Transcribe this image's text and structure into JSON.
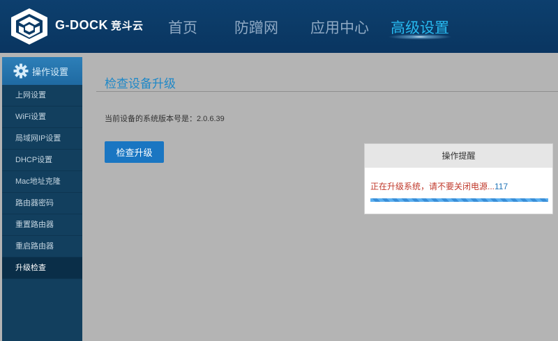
{
  "header": {
    "brand": "G-DOCK",
    "brand_cn": "竞斗云",
    "nav": [
      {
        "label": "首页"
      },
      {
        "label": "防蹭网"
      },
      {
        "label": "应用中心"
      },
      {
        "label": "高级设置"
      }
    ]
  },
  "sidebar": {
    "title": "操作设置",
    "items": [
      {
        "label": "上网设置"
      },
      {
        "label": "WiFi设置"
      },
      {
        "label": "局域网IP设置"
      },
      {
        "label": "DHCP设置"
      },
      {
        "label": "Mac地址克隆"
      },
      {
        "label": "路由器密码"
      },
      {
        "label": "重置路由器"
      },
      {
        "label": "重启路由器"
      },
      {
        "label": "升级检查"
      }
    ]
  },
  "main": {
    "title": "检查设备升级",
    "version_text": "当前设备的系统版本号是：2.0.6.39",
    "check_button": "检查升级"
  },
  "modal": {
    "title": "操作提醒",
    "message": "正在升级系统，请不要关闭电源...",
    "countdown": "117",
    "progress": 1.0
  },
  "colors": {
    "header_bg": "#0b3a66",
    "nav_active": "#27b9ef",
    "sidebar_bg": "#123f5e",
    "accent": "#1a76c2",
    "warning_text": "#c0392b"
  }
}
